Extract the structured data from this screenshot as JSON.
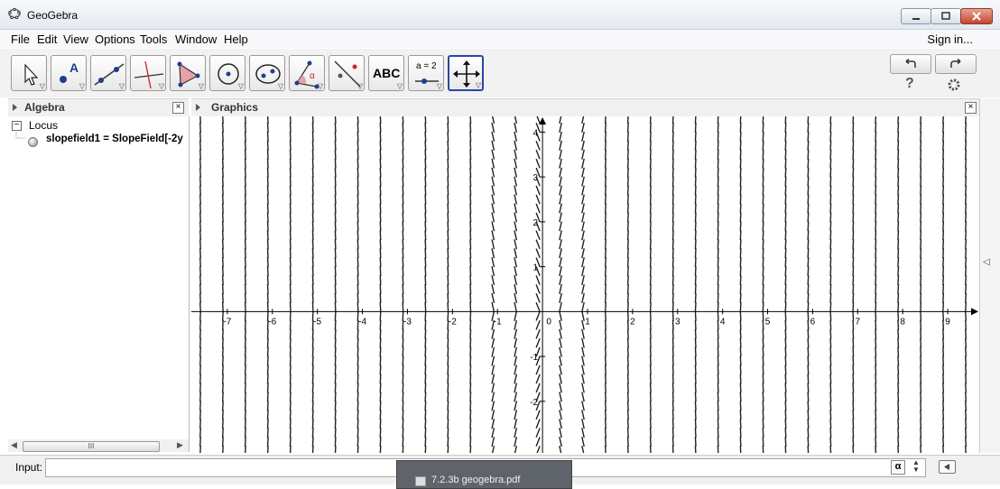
{
  "window": {
    "title": "GeoGebra"
  },
  "menu": [
    "File",
    "Edit",
    "View",
    "Options",
    "Tools",
    "Window",
    "Help"
  ],
  "sign_in": "Sign in...",
  "toolbar": {
    "tools": [
      {
        "name": "move-tool",
        "label": ""
      },
      {
        "name": "point-tool",
        "label": "A"
      },
      {
        "name": "line-tool",
        "label": ""
      },
      {
        "name": "perpendicular-line-tool",
        "label": ""
      },
      {
        "name": "polygon-tool",
        "label": ""
      },
      {
        "name": "circle-tool",
        "label": ""
      },
      {
        "name": "ellipse-tool",
        "label": ""
      },
      {
        "name": "angle-tool",
        "label": "α"
      },
      {
        "name": "reflect-tool",
        "label": ""
      },
      {
        "name": "text-tool",
        "label": "ABC"
      },
      {
        "name": "slider-tool",
        "label": "a = 2"
      },
      {
        "name": "move-graphics-view-tool",
        "label": ""
      }
    ],
    "help": "?"
  },
  "algebra": {
    "title": "Algebra",
    "group_label": "Locus",
    "item": "slopefield1 = SlopeField[-2y",
    "scroll_grip": "III"
  },
  "graphics": {
    "title": "Graphics",
    "x_ticks": [
      "-7",
      "-6",
      "-5",
      "-4",
      "-3",
      "-2",
      "-1",
      "0",
      "1",
      "2",
      "3",
      "4",
      "5",
      "6",
      "7",
      "8",
      "9"
    ],
    "y_ticks_pos": [
      "1",
      "2",
      "3",
      "4"
    ],
    "y_ticks_neg": [
      "-1",
      "-2"
    ],
    "x_range": [
      -7.8,
      9.7
    ],
    "y_range": [
      -3.15,
      4.35
    ]
  },
  "input": {
    "label": "Input:",
    "value": "",
    "alpha": "α"
  },
  "taskbar": {
    "label": "7.2.3b geogebra.pdf"
  },
  "colors": {
    "active_tool_border": "#2a46a8",
    "close_button": "#c6452f"
  }
}
